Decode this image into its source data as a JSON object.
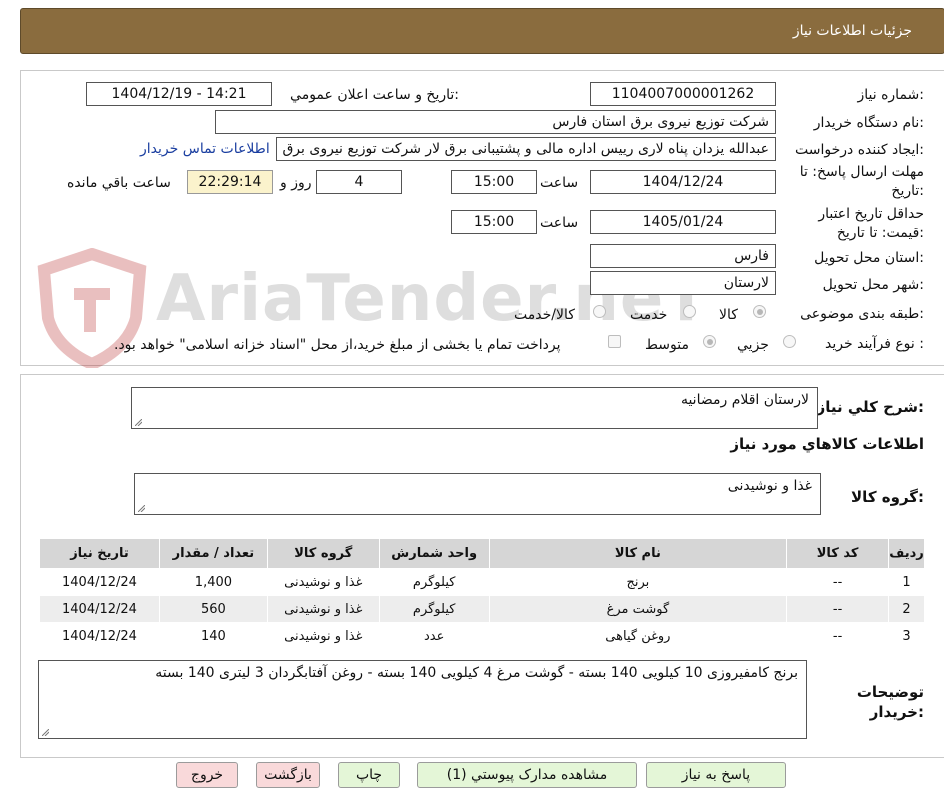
{
  "header": {
    "title": "جزئیات اطلاعات نیاز"
  },
  "watermark": {
    "text": "AriaTender.neT"
  },
  "form": {
    "need_number": {
      "label": "شماره نیاز:",
      "value": "1104007000001262"
    },
    "announce": {
      "label": "تاریخ و ساعت اعلان عمومي:",
      "value": "1404/12/19 - 14:21"
    },
    "buyer_org": {
      "label": "نام دستگاه خریدار:",
      "value": "شرکت توزیع نیروی برق استان فارس"
    },
    "creator": {
      "label": "ایجاد کننده درخواست:",
      "value": "عبدالله یزدان پناه لاری رییس اداره مالی و پشتیبانی برق لار شرکت توزیع نیروی برق استان فارس",
      "contact_link": "اطلاعات تماس خریدار"
    },
    "deadline": {
      "label": "مهلت ارسال پاسخ: تا تاریخ:",
      "date": "1404/12/24",
      "time_label": "ساعت",
      "time": "15:00",
      "days": "4",
      "days_label": "روز و",
      "remaining": "22:29:14",
      "remaining_label": "ساعت باقي مانده"
    },
    "validity": {
      "label": "حداقل تاریخ اعتبار قیمت: تا تاریخ:",
      "date": "1405/01/24",
      "time_label": "ساعت",
      "time": "15:00"
    },
    "province": {
      "label": "استان محل تحویل:",
      "value": "فارس"
    },
    "city": {
      "label": "شهر محل تحویل:",
      "value": "لارستان"
    },
    "category": {
      "label": "طبقه بندی موضوعی:",
      "options": [
        "کالا",
        "خدمت",
        "کالا/خدمت"
      ],
      "selected": "کالا"
    },
    "process": {
      "label": "نوع فرآیند خرید :",
      "options": [
        "جزیي",
        "متوسط"
      ],
      "selected": "متوسط",
      "note": "پرداخت تمام یا بخشی از مبلغ خرید،از محل \"اسناد خزانه اسلامی\" خواهد بود."
    }
  },
  "general": {
    "summary_label": "شرح کلي نياز:",
    "summary": "لارستان اقلام رمضانیه",
    "items_title": "اطلاعات کالاهاي مورد نياز",
    "group_label": "گروه کالا:",
    "group": "غذا و نوشیدنی"
  },
  "table": {
    "headers": [
      "ردیف",
      "کد کالا",
      "نام کالا",
      "واحد شمارش",
      "گروه کالا",
      "تعداد / مقدار",
      "تاریخ نیاز"
    ],
    "rows": [
      [
        "1",
        "--",
        "برنج",
        "کیلوگرم",
        "غذا و نوشیدنی",
        "1,400",
        "1404/12/24"
      ],
      [
        "2",
        "--",
        "گوشت مرغ",
        "کیلوگرم",
        "غذا و نوشیدنی",
        "560",
        "1404/12/24"
      ],
      [
        "3",
        "--",
        "روغن گیاهی",
        "عدد",
        "غذا و نوشیدنی",
        "140",
        "1404/12/24"
      ]
    ]
  },
  "buyer_notes": {
    "label": "توضیحات خریدار:",
    "text": "برنج کامفیروزی 10 کیلویی 140 بسته - گوشت مرغ 4 کیلویی 140 بسته - روغن آفتابگردان 3 لیتری 140 بسته"
  },
  "buttons": {
    "reply": "پاسخ به نیاز",
    "attachments": "مشاهده مدارک پیوستي (1)",
    "print": "چاپ",
    "back": "بازگشت",
    "exit": "خروج"
  }
}
